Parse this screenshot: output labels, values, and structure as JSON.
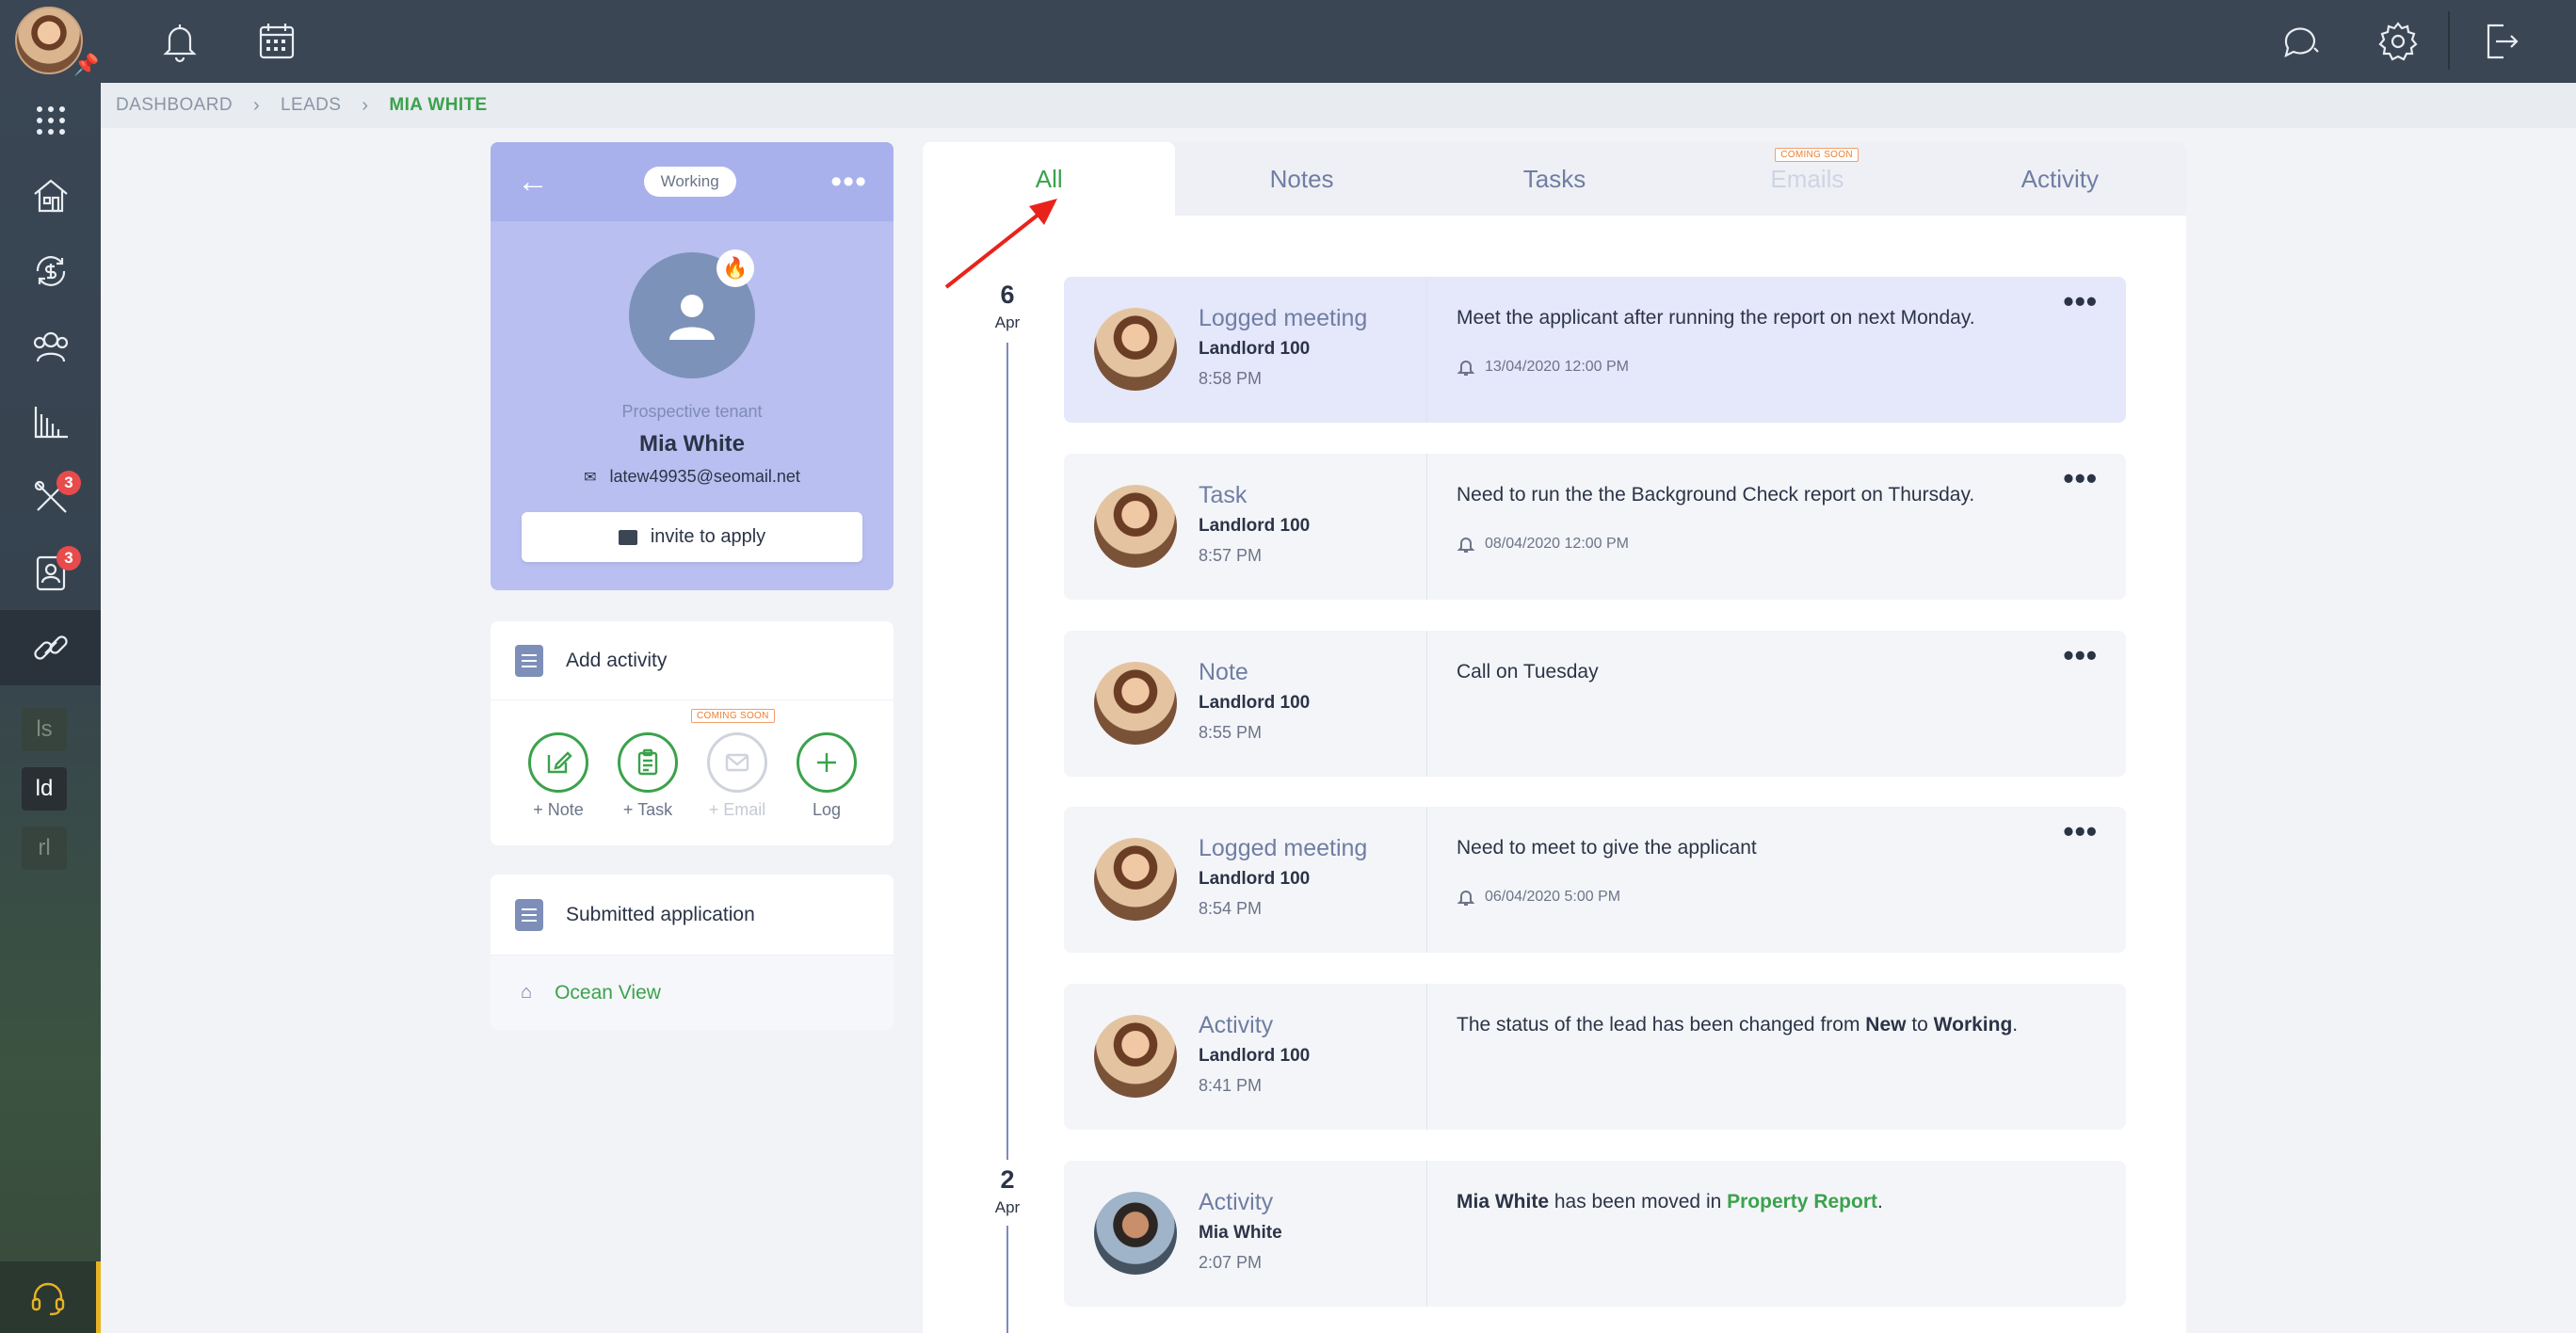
{
  "breadcrumb": {
    "items": [
      "DASHBOARD",
      "LEADS"
    ],
    "current": "MIA WHITE"
  },
  "sidebar": {
    "badges": {
      "tools": "3",
      "contacts": "3"
    },
    "letters": [
      "ls",
      "ld",
      "rl"
    ]
  },
  "lead": {
    "status": "Working",
    "role": "Prospective tenant",
    "name": "Mia White",
    "email": "latew49935@seomail.net",
    "invite_label": "invite to apply"
  },
  "add_activity": {
    "title": "Add activity",
    "coming_soon": "COMING SOON",
    "actions": [
      "+ Note",
      "+ Task",
      "+ Email",
      "Log"
    ]
  },
  "application": {
    "title": "Submitted application",
    "property": "Ocean View"
  },
  "tabs": {
    "items": [
      "All",
      "Notes",
      "Tasks",
      "Emails",
      "Activity"
    ],
    "coming_soon": "COMING SOON",
    "active": "All"
  },
  "dates": [
    {
      "day": "6",
      "month": "Apr"
    },
    {
      "day": "2",
      "month": "Apr"
    }
  ],
  "timeline": [
    {
      "type": "Logged meeting",
      "owner": "Landlord 100",
      "time": "8:58 PM",
      "text": "Meet the applicant after running the report on next Monday.",
      "reminder": "13/04/2020 12:00 PM"
    },
    {
      "type": "Task",
      "owner": "Landlord 100",
      "time": "8:57 PM",
      "text": "Need to run the the Background Check report on Thursday.",
      "reminder": "08/04/2020 12:00 PM"
    },
    {
      "type": "Note",
      "owner": "Landlord 100",
      "time": "8:55 PM",
      "text": "Call on Tuesday"
    },
    {
      "type": "Logged meeting",
      "owner": "Landlord 100",
      "time": "8:54 PM",
      "text": "Need to meet to give the applicant",
      "reminder": "06/04/2020 5:00 PM"
    },
    {
      "type": "Activity",
      "owner": "Landlord 100",
      "time": "8:41 PM",
      "text_parts": [
        "The status of the lead has been changed from ",
        "New",
        " to ",
        "Working",
        "."
      ]
    },
    {
      "type": "Activity",
      "owner": "Mia White",
      "time": "2:07 PM",
      "text_parts": [
        "Mia White",
        " has been moved in ",
        "Property Report",
        "."
      ]
    }
  ],
  "colors": {
    "accent_green": "#3ba24c",
    "lavender": "#b9bff0",
    "navy": "#3a4654",
    "annotation_arrow": "#e8231b"
  },
  "icons": {
    "topbar": [
      "bell-icon",
      "calendar-icon",
      "chat-icon",
      "gear-icon",
      "logout-icon"
    ],
    "sidebar": [
      "apps-grid-icon",
      "house-icon",
      "money-cycle-icon",
      "users-icon",
      "chart-icon",
      "tools-icon",
      "contact-card-icon",
      "link-icon",
      "headset-icon"
    ]
  }
}
